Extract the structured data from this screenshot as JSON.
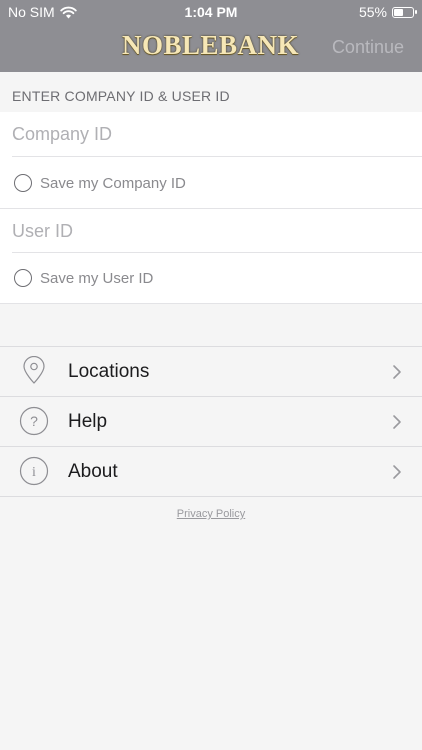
{
  "status_bar": {
    "carrier": "No SIM",
    "time": "1:04 PM",
    "battery": "55%",
    "battery_level": 0.55
  },
  "nav": {
    "logo": "NOBLEBANK",
    "continue_label": "Continue"
  },
  "form": {
    "section_header": "ENTER COMPANY ID & USER ID",
    "company_id_placeholder": "Company ID",
    "save_company_label": "Save my Company ID",
    "user_id_placeholder": "User ID",
    "save_user_label": "Save my User ID"
  },
  "menu": {
    "items": [
      {
        "label": "Locations",
        "icon": "location-pin-icon"
      },
      {
        "label": "Help",
        "icon": "question-icon"
      },
      {
        "label": "About",
        "icon": "info-icon"
      }
    ]
  },
  "footer": {
    "privacy_label": "Privacy Policy"
  }
}
